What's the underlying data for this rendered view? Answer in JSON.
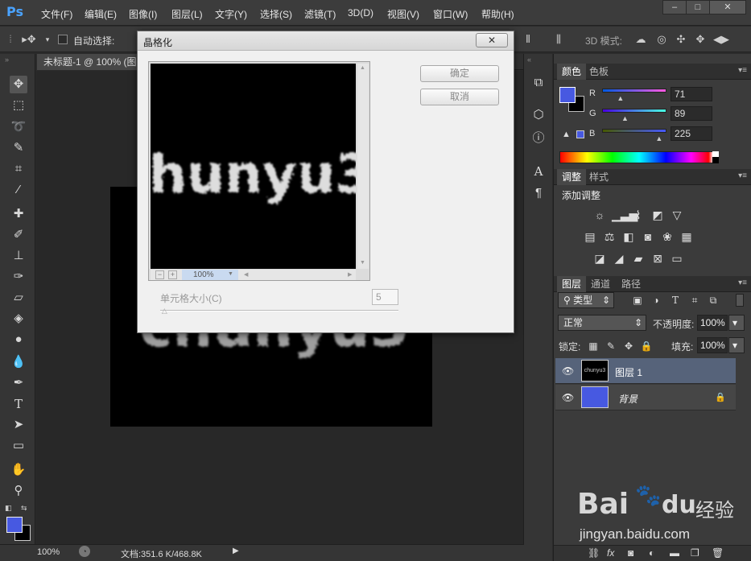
{
  "app": {
    "logo": "Ps",
    "menu": [
      "文件(F)",
      "编辑(E)",
      "图像(I)",
      "图层(L)",
      "文字(Y)",
      "选择(S)",
      "滤镜(T)",
      "3D(D)",
      "视图(V)",
      "窗口(W)",
      "帮助(H)"
    ],
    "window_controls": [
      "–",
      "□",
      "✕"
    ]
  },
  "options_bar": {
    "auto_select_label": "自动选择:",
    "mode_3d_label": "3D 模式:"
  },
  "document": {
    "tab_title": "未标题-1 @ 100% (图",
    "canvas_text": "chunyu3",
    "zoom": "100%",
    "doc_size": "文档:351.6 K/468.8K"
  },
  "dialog": {
    "title": "晶格化",
    "close": "✕",
    "ok_label": "确定",
    "cancel_label": "取消",
    "preview_text": "hunyu3",
    "preview_zoom": "100%",
    "zoom_minus": "−",
    "zoom_plus": "+",
    "cell_size_label": "单元格大小(C)",
    "cell_size_value": "5",
    "cell_size_fraction": 0.02
  },
  "color_panel": {
    "tabs": [
      "颜色",
      "色板"
    ],
    "channels": [
      {
        "label": "R",
        "value": "71",
        "level": 0.28
      },
      {
        "label": "G",
        "value": "89",
        "level": 0.35
      },
      {
        "label": "B",
        "value": "225",
        "level": 0.88
      }
    ],
    "foreground": "#4759e1",
    "background": "#000000"
  },
  "adjustments_panel": {
    "tabs": [
      "调整",
      "样式"
    ],
    "title": "添加调整"
  },
  "layers_panel": {
    "tabs": [
      "图层",
      "通道",
      "路径"
    ],
    "filter_kind": "类型",
    "blend_mode": "正常",
    "opacity_label": "不透明度:",
    "opacity_value": "100%",
    "lock_label": "锁定:",
    "fill_label": "填充:",
    "fill_value": "100%",
    "layers": [
      {
        "name": "图层 1",
        "thumb_text": "chunyu3",
        "selected": true
      },
      {
        "name": "背景",
        "locked": true,
        "selected": false
      }
    ]
  },
  "watermark": {
    "brand": "Bai",
    "brand2": "du",
    "cn": "经验",
    "url": "jingyan.baidu.com"
  }
}
